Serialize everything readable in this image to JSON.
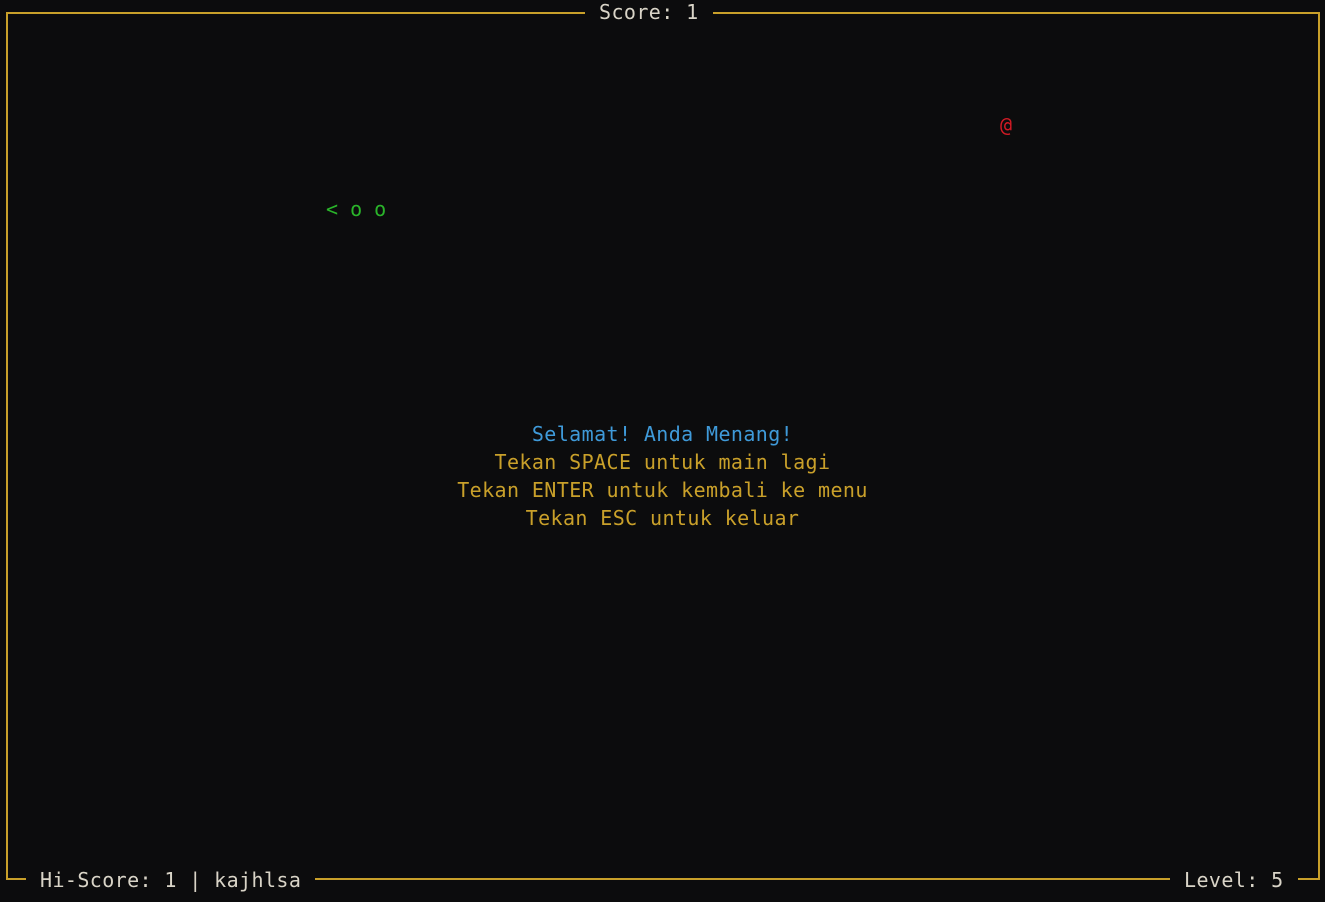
{
  "header": {
    "score_text": "Score: 1"
  },
  "footer": {
    "hiscore_text": "Hi-Score: 1 | kajhlsa",
    "level_text": "Level: 5"
  },
  "game": {
    "snake_text": "< o o",
    "food_glyph": "@"
  },
  "overlay": {
    "win_message": "Selamat! Anda Menang!",
    "space_hint": "Tekan SPACE untuk main lagi",
    "enter_hint": "Tekan ENTER untuk kembali ke menu",
    "esc_hint": "Tekan ESC untuk keluar"
  },
  "colors": {
    "border": "#c9a02a",
    "snake": "#2ab52a",
    "food": "#d01a24",
    "win_text": "#3f9ad9",
    "hint_text": "#c9a02a",
    "background": "#0c0c0d"
  }
}
